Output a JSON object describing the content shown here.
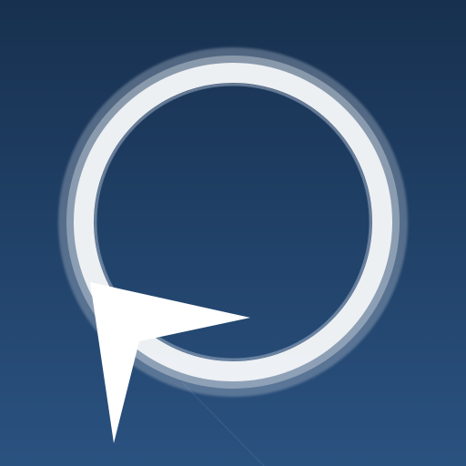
{
  "app_icon": {
    "icon": "ring-with-pointer-arrow",
    "colors": {
      "background_top": "#17304f",
      "background_bottom": "#2a5280",
      "ring": "#f2f4f7",
      "ring_glow": "#b9c3d1",
      "pointer": "#ffffff"
    }
  }
}
